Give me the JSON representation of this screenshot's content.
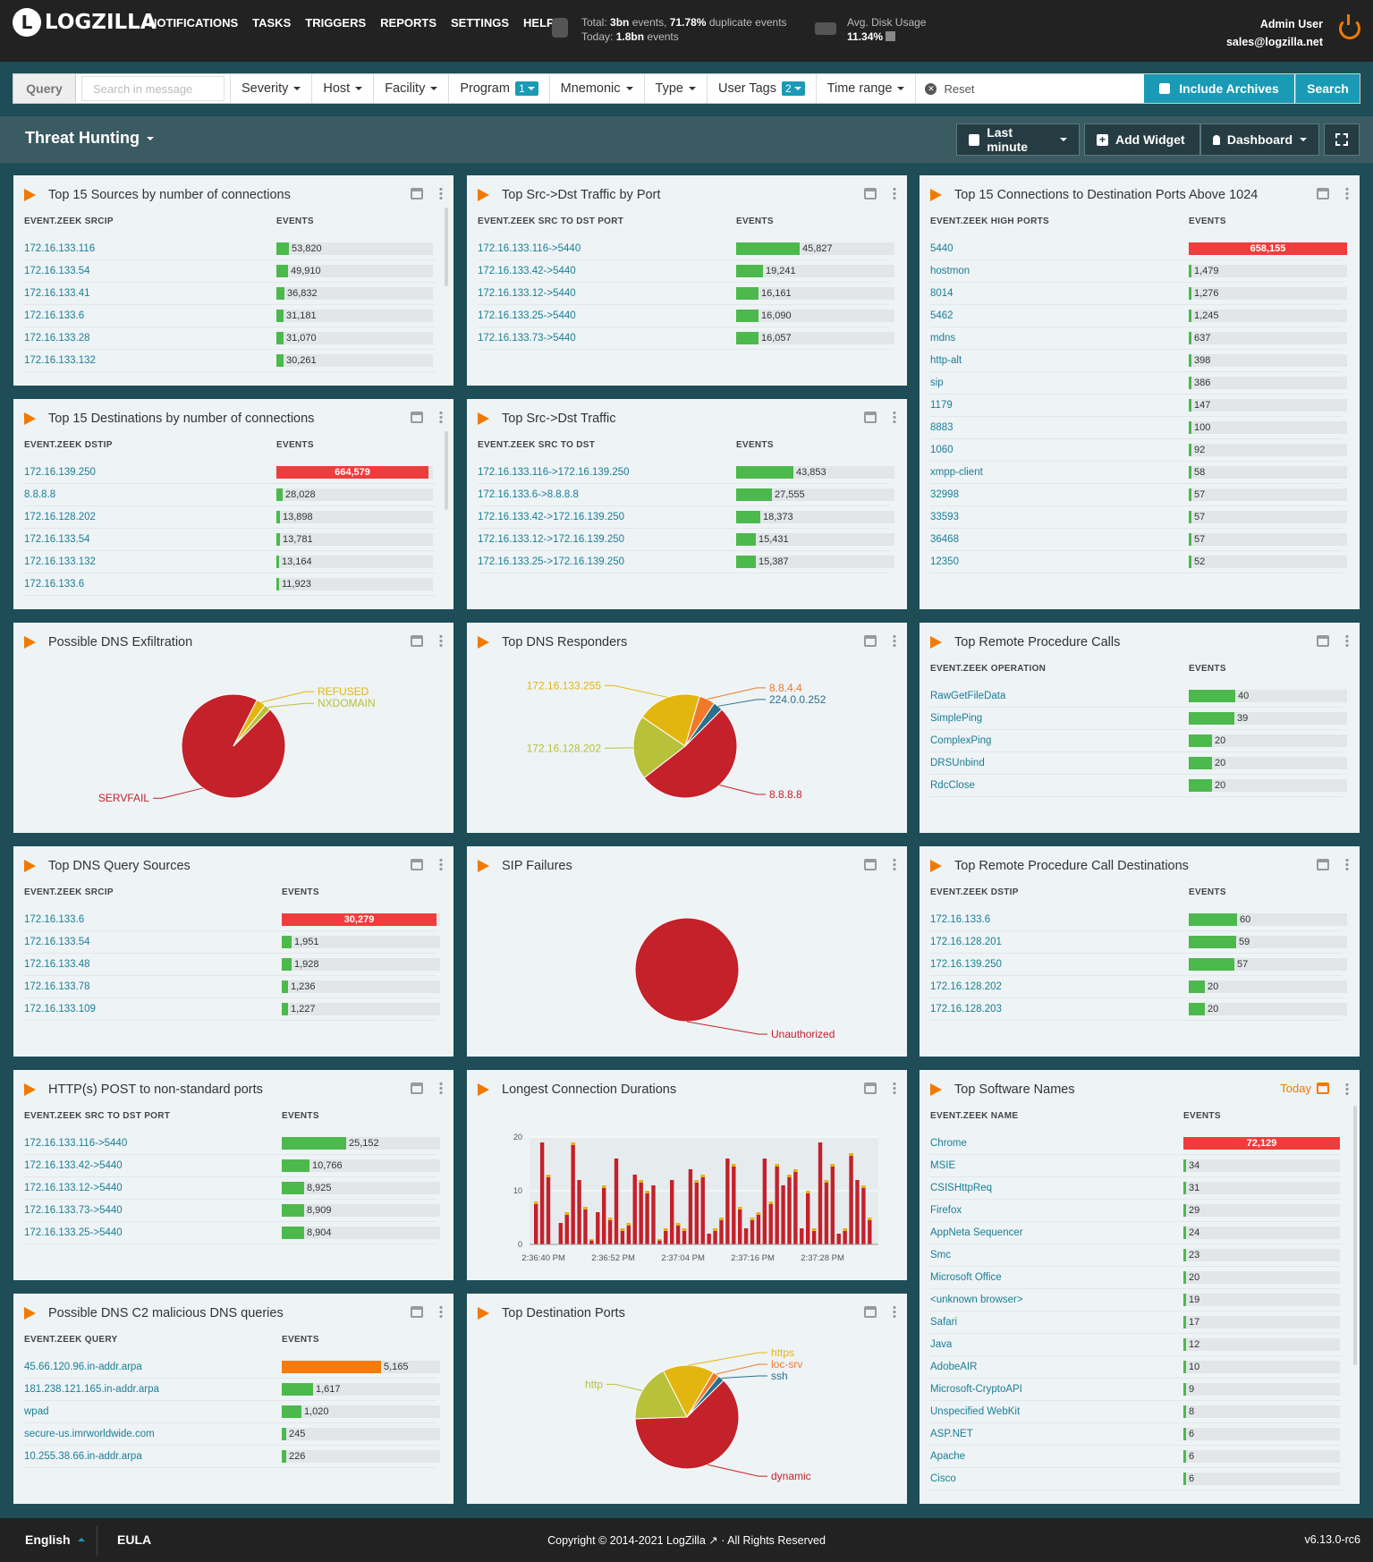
{
  "brand": {
    "logo_letter": "L",
    "name": "LOGZILLA"
  },
  "nav": [
    "NOTIFICATIONS",
    "TASKS",
    "TRIGGERS",
    "REPORTS",
    "SETTINGS",
    "HELP"
  ],
  "stats": {
    "total_label": "Total:",
    "total_events": "3bn",
    "total_events_unit": "events,",
    "duplicate_pct": "71.78%",
    "duplicate_label": "duplicate events",
    "today_label": "Today:",
    "today_events": "1.8bn",
    "today_unit": "events",
    "disk_label": "Avg. Disk Usage",
    "disk_value": "11.34%"
  },
  "user": {
    "name": "Admin User",
    "email": "sales@logzilla.net"
  },
  "query": {
    "label": "Query",
    "placeholder": "Search in message",
    "filters": [
      {
        "label": "Severity"
      },
      {
        "label": "Host"
      },
      {
        "label": "Facility"
      },
      {
        "label": "Program",
        "badge": "1"
      },
      {
        "label": "Mnemonic"
      },
      {
        "label": "Type"
      },
      {
        "label": "User Tags",
        "badge": "2"
      },
      {
        "label": "Time range"
      }
    ],
    "reset": "Reset",
    "archives": "Include Archives",
    "search": "Search"
  },
  "dashboard": {
    "title": "Threat Hunting",
    "time_button": "Last minute",
    "add_widget": "Add Widget",
    "dashboard_button": "Dashboard"
  },
  "widgets": {
    "w1": {
      "title": "Top 15 Sources by number of connections",
      "col1": "EVENT.ZEEK SRCIP",
      "col2": "EVENTS",
      "rows": [
        [
          "172.16.133.116",
          "53,820",
          53820
        ],
        [
          "172.16.133.54",
          "49,910",
          49910
        ],
        [
          "172.16.133.41",
          "36,832",
          36832
        ],
        [
          "172.16.133.6",
          "31,181",
          31181
        ],
        [
          "172.16.133.28",
          "31,070",
          31070
        ],
        [
          "172.16.133.132",
          "30,261",
          30261
        ]
      ]
    },
    "w2": {
      "title": "Top Src->Dst Traffic by Port",
      "col1": "EVENT.ZEEK SRC TO DST PORT",
      "col2": "EVENTS",
      "rows": [
        [
          "172.16.133.116->5440",
          "45,827",
          45827
        ],
        [
          "172.16.133.42->5440",
          "19,241",
          19241
        ],
        [
          "172.16.133.12->5440",
          "16,161",
          16161
        ],
        [
          "172.16.133.25->5440",
          "16,090",
          16090
        ],
        [
          "172.16.133.73->5440",
          "16,057",
          16057
        ]
      ]
    },
    "w3": {
      "title": "Top 15 Connections to Destination Ports Above 1024",
      "col1": "EVENT.ZEEK HIGH PORTS",
      "col2": "EVENTS",
      "rows": [
        [
          "5440",
          "658,155",
          658155
        ],
        [
          "hostmon",
          "1,479",
          1479
        ],
        [
          "8014",
          "1,276",
          1276
        ],
        [
          "5462",
          "1,245",
          1245
        ],
        [
          "mdns",
          "637",
          637
        ],
        [
          "http-alt",
          "398",
          398
        ],
        [
          "sip",
          "386",
          386
        ],
        [
          "1179",
          "147",
          147
        ],
        [
          "8883",
          "100",
          100
        ],
        [
          "1060",
          "92",
          92
        ],
        [
          "xmpp-client",
          "58",
          58
        ],
        [
          "32998",
          "57",
          57
        ],
        [
          "33593",
          "57",
          57
        ],
        [
          "36468",
          "57",
          57
        ],
        [
          "12350",
          "52",
          52
        ]
      ]
    },
    "w4": {
      "title": "Top 15 Destinations by number of connections",
      "col1": "EVENT.ZEEK DSTIP",
      "col2": "EVENTS",
      "rows": [
        [
          "172.16.139.250",
          "664,579",
          664579
        ],
        [
          "8.8.8.8",
          "28,028",
          28028
        ],
        [
          "172.16.128.202",
          "13,898",
          13898
        ],
        [
          "172.16.133.54",
          "13,781",
          13781
        ],
        [
          "172.16.133.132",
          "13,164",
          13164
        ],
        [
          "172.16.133.6",
          "11,923",
          11923
        ]
      ]
    },
    "w5": {
      "title": "Top Src->Dst Traffic",
      "col1": "EVENT.ZEEK SRC TO DST",
      "col2": "EVENTS",
      "rows": [
        [
          "172.16.133.116->172.16.139.250",
          "43,853",
          43853
        ],
        [
          "172.16.133.6->8.8.8.8",
          "27,555",
          27555
        ],
        [
          "172.16.133.42->172.16.139.250",
          "18,373",
          18373
        ],
        [
          "172.16.133.12->172.16.139.250",
          "15,431",
          15431
        ],
        [
          "172.16.133.25->172.16.139.250",
          "15,387",
          15387
        ]
      ]
    },
    "w6": {
      "title": "Possible DNS Exfiltration"
    },
    "w7": {
      "title": "Top DNS Responders"
    },
    "w8": {
      "title": "Top Remote Procedure Calls",
      "col1": "EVENT.ZEEK OPERATION",
      "col2": "EVENTS",
      "rows": [
        [
          "RawGetFileData",
          "40",
          40
        ],
        [
          "SimplePing",
          "39",
          39
        ],
        [
          "ComplexPing",
          "20",
          20
        ],
        [
          "DRSUnbind",
          "20",
          20
        ],
        [
          "RdcClose",
          "20",
          20
        ]
      ]
    },
    "w9": {
      "title": "Top DNS Query Sources",
      "col1": "EVENT.ZEEK SRCIP",
      "col2": "EVENTS",
      "rows": [
        [
          "172.16.133.6",
          "30,279",
          30279
        ],
        [
          "172.16.133.54",
          "1,951",
          1951
        ],
        [
          "172.16.133.48",
          "1,928",
          1928
        ],
        [
          "172.16.133.78",
          "1,236",
          1236
        ],
        [
          "172.16.133.109",
          "1,227",
          1227
        ]
      ]
    },
    "w10": {
      "title": "SIP Failures"
    },
    "w11": {
      "title": "Top Remote Procedure Call Destinations",
      "col1": "EVENT.ZEEK DSTIP",
      "col2": "EVENTS",
      "rows": [
        [
          "172.16.133.6",
          "60",
          60
        ],
        [
          "172.16.128.201",
          "59",
          59
        ],
        [
          "172.16.139.250",
          "57",
          57
        ],
        [
          "172.16.128.202",
          "20",
          20
        ],
        [
          "172.16.128.203",
          "20",
          20
        ]
      ]
    },
    "w12": {
      "title": "HTTP(s) POST to non-standard ports",
      "col1": "EVENT.ZEEK SRC TO DST PORT",
      "col2": "EVENTS",
      "rows": [
        [
          "172.16.133.116->5440",
          "25,152",
          25152
        ],
        [
          "172.16.133.42->5440",
          "10,766",
          10766
        ],
        [
          "172.16.133.12->5440",
          "8,925",
          8925
        ],
        [
          "172.16.133.73->5440",
          "8,909",
          8909
        ],
        [
          "172.16.133.25->5440",
          "8,904",
          8904
        ]
      ]
    },
    "w13": {
      "title": "Longest Connection Durations"
    },
    "w14": {
      "title": "Top Software Names",
      "today": "Today",
      "col1": "EVENT.ZEEK NAME",
      "col2": "EVENTS",
      "rows": [
        [
          "Chrome",
          "72,129",
          72129
        ],
        [
          "MSIE",
          "34",
          34
        ],
        [
          "CSISHttpReq",
          "31",
          31
        ],
        [
          "Firefox",
          "29",
          29
        ],
        [
          "AppNeta Sequencer",
          "24",
          24
        ],
        [
          "Smc",
          "23",
          23
        ],
        [
          "Microsoft Office",
          "20",
          20
        ],
        [
          "<unknown browser>",
          "19",
          19
        ],
        [
          "Safari",
          "17",
          17
        ],
        [
          "Java",
          "12",
          12
        ],
        [
          "AdobeAIR",
          "10",
          10
        ],
        [
          "Microsoft-CryptoAPI",
          "9",
          9
        ],
        [
          "Unspecified WebKit",
          "8",
          8
        ],
        [
          "ASP.NET",
          "6",
          6
        ],
        [
          "Apache",
          "6",
          6
        ],
        [
          "Cisco",
          "6",
          6
        ]
      ]
    },
    "w15": {
      "title": "Possible DNS C2 malicious DNS queries",
      "col1": "EVENT.ZEEK QUERY",
      "col2": "EVENTS",
      "rows": [
        [
          "45.66.120.96.in-addr.arpa",
          "5,165",
          5165
        ],
        [
          "181.238.121.165.in-addr.arpa",
          "1,617",
          1617
        ],
        [
          "wpad",
          "1,020",
          1020
        ],
        [
          "secure-us.imrworldwide.com",
          "245",
          245
        ],
        [
          "10.255.38.66.in-addr.arpa",
          "226",
          226
        ]
      ]
    },
    "w16": {
      "title": "Top Destination Ports"
    }
  },
  "colors": {
    "red": "#c4212b",
    "yellow": "#e3b60f",
    "olive": "#b8c13a",
    "orange": "#f07a2a",
    "teal": "#2d6f8a",
    "bar_green": "#4cb94c",
    "bar_red": "#f03c3c",
    "bar_orange": "#f57c0a",
    "accent": "#1a9ab5"
  },
  "chart_data": [
    {
      "type": "pie",
      "widget": "Possible DNS Exfiltration",
      "slices": [
        {
          "label": "SERVFAIL",
          "value": 95,
          "color": "#c4212b"
        },
        {
          "label": "REFUSED",
          "value": 3,
          "color": "#e3b60f"
        },
        {
          "label": "NXDOMAIN",
          "value": 2,
          "color": "#b8c13a"
        }
      ]
    },
    {
      "type": "pie",
      "widget": "Top DNS Responders",
      "slices": [
        {
          "label": "8.8.8.8",
          "value": 52,
          "color": "#c4212b"
        },
        {
          "label": "172.16.128.202",
          "value": 20,
          "color": "#b8c13a"
        },
        {
          "label": "172.16.133.255",
          "value": 20,
          "color": "#e3b60f"
        },
        {
          "label": "8.8.4.4",
          "value": 5,
          "color": "#f07a2a"
        },
        {
          "label": "224.0.0.252",
          "value": 3,
          "color": "#2d6f8a"
        }
      ]
    },
    {
      "type": "pie",
      "widget": "SIP Failures",
      "slices": [
        {
          "label": "Unauthorized",
          "value": 100,
          "color": "#c4212b"
        }
      ]
    },
    {
      "type": "pie",
      "widget": "Top Destination Ports",
      "slices": [
        {
          "label": "dynamic",
          "value": 62,
          "color": "#c4212b"
        },
        {
          "label": "http",
          "value": 18,
          "color": "#b8c13a"
        },
        {
          "label": "https",
          "value": 16,
          "color": "#e3b60f"
        },
        {
          "label": "loc-srv",
          "value": 2,
          "color": "#f07a2a"
        },
        {
          "label": "ssh",
          "value": 2,
          "color": "#2d6f8a"
        }
      ]
    },
    {
      "type": "bar",
      "widget": "Longest Connection Durations",
      "ylim": [
        0,
        20
      ],
      "yticks": [
        0,
        10,
        20
      ],
      "xticks": [
        "2:36:40 PM",
        "2:36:52 PM",
        "2:37:04 PM",
        "2:37:16 PM",
        "2:37:28 PM"
      ],
      "values": [
        8,
        19,
        13,
        0,
        4,
        6,
        19,
        12,
        7,
        1,
        6,
        11,
        5,
        16,
        3,
        4,
        13,
        12,
        10,
        11,
        1,
        3,
        12,
        4,
        3,
        14,
        12,
        13,
        2,
        3,
        5,
        16,
        15,
        7,
        3,
        5,
        6,
        16,
        8,
        15,
        11,
        13,
        14,
        3,
        10,
        3,
        19,
        12,
        15,
        2,
        3,
        17,
        12,
        11,
        5
      ]
    }
  ],
  "footer": {
    "language": "English",
    "eula": "EULA",
    "copyright": "Copyright © 2014-2021 LogZilla ↗ · All Rights Reserved",
    "version": "v6.13.0-rc6"
  }
}
